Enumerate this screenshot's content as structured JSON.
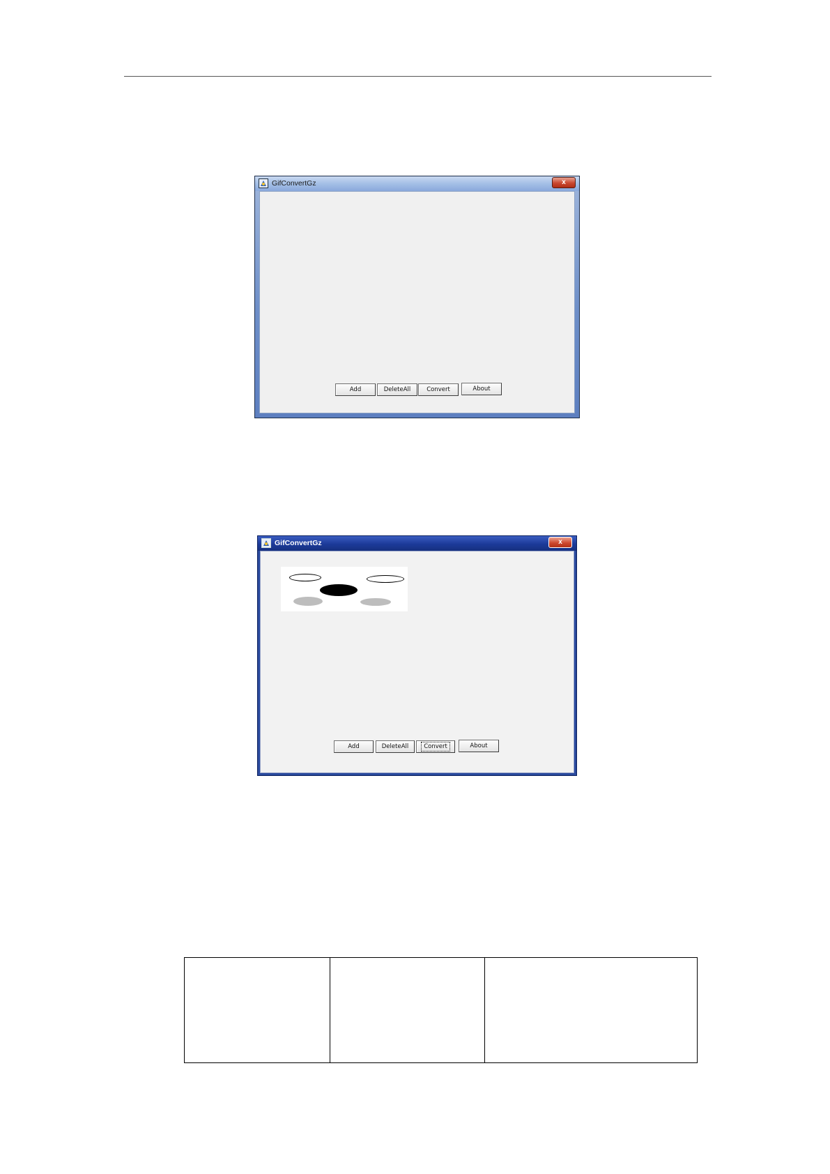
{
  "window1": {
    "title": "GifConvertGz",
    "close_glyph": "x",
    "buttons": [
      {
        "label": "Add"
      },
      {
        "label": "DeleteAll"
      },
      {
        "label": "Convert"
      },
      {
        "label": "About"
      }
    ]
  },
  "window2": {
    "title": "GifConvertGz",
    "close_glyph": "x",
    "focused_button": "Convert",
    "buttons": [
      {
        "label": "Add"
      },
      {
        "label": "DeleteAll"
      },
      {
        "label": "Convert"
      },
      {
        "label": "About"
      }
    ],
    "preview_image": {
      "shapes": [
        {
          "name": "outline-ellipse",
          "fill": "#ffffff",
          "stroke": "#000000"
        },
        {
          "name": "black-ellipse",
          "fill": "#000000"
        },
        {
          "name": "outline-ellipse",
          "fill": "#ffffff",
          "stroke": "#000000"
        },
        {
          "name": "gray-ellipse",
          "fill": "#bdbdbd"
        },
        {
          "name": "gray-ellipse",
          "fill": "#bdbdbd"
        }
      ]
    }
  },
  "table": {
    "rows": [
      [
        "",
        "",
        ""
      ]
    ]
  },
  "icons": {
    "app": "gifconvert-app-icon",
    "close": "close-icon"
  }
}
